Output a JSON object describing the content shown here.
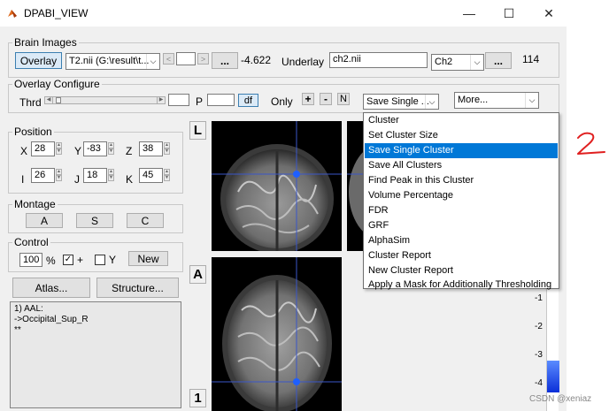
{
  "window": {
    "title": "DPABI_VIEW",
    "minimize": "—",
    "maximize": "☐",
    "close": "✕"
  },
  "brain_images": {
    "title": "Brain Images",
    "overlay_button": "Overlay",
    "overlay_file": "T2.nii (G:\\result\\t...",
    "prev": "<",
    "next": ">",
    "browse": "...",
    "value": "-4.622",
    "underlay_label": "Underlay",
    "underlay_file": "ch2.nii",
    "underlay_combo": "Ch2",
    "underlay_browse": "...",
    "number": "114"
  },
  "overlay_configure": {
    "title": "Overlay Configure",
    "thrd_label": "Thrd",
    "p_label": "P",
    "df_button": "df",
    "only_label": "Only",
    "plus": "+",
    "minus": "-",
    "n": "N",
    "cluster_combo": "Save Single ...",
    "more_combo": "More..."
  },
  "cluster_menu": {
    "items": [
      "Cluster",
      "Set Cluster Size",
      "Save Single Cluster",
      "Save All Clusters",
      "Find Peak in this Cluster",
      "Volume Percentage",
      "FDR",
      "GRF",
      "AlphaSim",
      "Cluster Report",
      "New Cluster Report",
      "Apply a Mask for Additionally Thresholding"
    ],
    "selected_index": 2
  },
  "position": {
    "title": "Position",
    "x_label": "X",
    "x_value": "28",
    "y_label": "Y",
    "y_value": "-83",
    "z_label": "Z",
    "z_value": "38",
    "i_label": "I",
    "i_value": "26",
    "j_label": "J",
    "j_value": "18",
    "k_label": "K",
    "k_value": "45"
  },
  "montage": {
    "title": "Montage",
    "a": "A",
    "s": "S",
    "c": "C"
  },
  "control": {
    "title": "Control",
    "zoom": "100",
    "percent": "%",
    "plus_check": "+",
    "plus_checked": "✓",
    "y_check": "Y",
    "new_button": "New"
  },
  "atlas_button": "Atlas...",
  "structure_button": "Structure...",
  "info": {
    "line1": "1) AAL:",
    "line2": "->Occipital_Sup_R",
    "line3": "**"
  },
  "view_labels": {
    "left": "L",
    "anterior": "A",
    "one": "1"
  },
  "colorbar": {
    "ticks": [
      "-1",
      "-2",
      "-3",
      "-4"
    ],
    "accent": "#0078d7"
  },
  "annotation": "2",
  "watermark": "CSDN @xeniaz"
}
